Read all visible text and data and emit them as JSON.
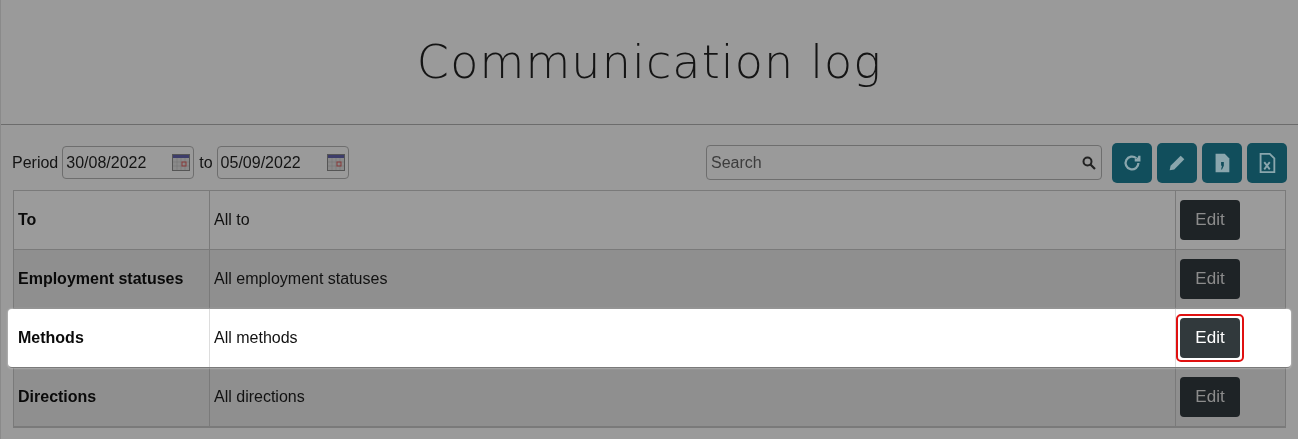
{
  "title": "Communication log",
  "period": {
    "label": "Period",
    "from": "30/08/2022",
    "separator": "to",
    "to": "05/09/2022"
  },
  "search": {
    "placeholder": "Search"
  },
  "toolbar": [
    {
      "kind": "refresh"
    },
    {
      "kind": "edit"
    },
    {
      "kind": "csv"
    },
    {
      "kind": "excel"
    }
  ],
  "rows": [
    {
      "label": "To",
      "value": "All to",
      "button": "Edit",
      "highlighted": false
    },
    {
      "label": "Employment statuses",
      "value": "All employment statuses",
      "button": "Edit",
      "highlighted": false
    },
    {
      "label": "Methods",
      "value": "All methods",
      "button": "Edit",
      "highlighted": true
    },
    {
      "label": "Directions",
      "value": "All directions",
      "button": "Edit",
      "highlighted": false
    }
  ]
}
